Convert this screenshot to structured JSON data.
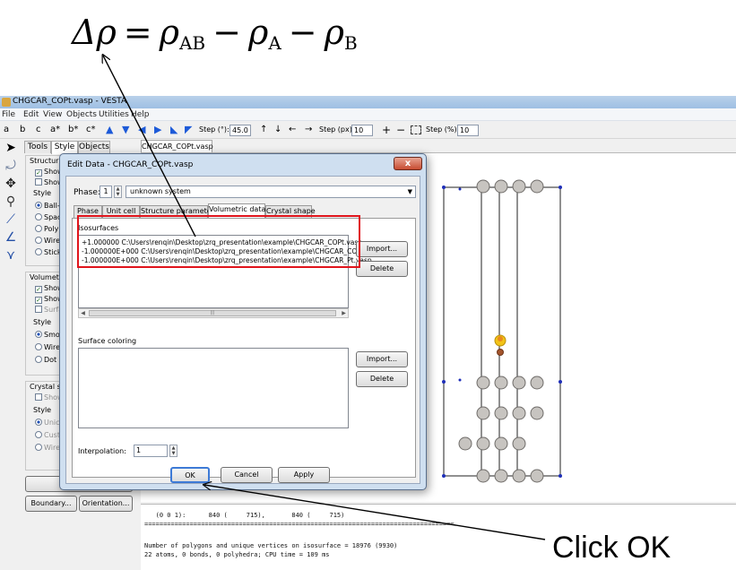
{
  "annotation": {
    "formula": {
      "delta_rho": "Δρ",
      "equals": "=",
      "minus": "−",
      "rho": "ρ",
      "sub_ab": "AB",
      "sub_a": "A",
      "sub_b": "B"
    },
    "instruction": "Click OK"
  },
  "window": {
    "title": "CHGCAR_COPt.vasp - VESTA"
  },
  "menu": [
    "File",
    "Edit",
    "View",
    "Objects",
    "Utilities",
    "Help"
  ],
  "toolbar": {
    "axes": [
      "a",
      "b",
      "c",
      "a*",
      "b*",
      "c*"
    ],
    "rotate_arrows": [
      "▲",
      "▼",
      "◀",
      "▶",
      "◣",
      "◤"
    ],
    "step_deg_label": "Step (°):",
    "step_deg_value": "45.0",
    "translate_arrows": [
      "↑",
      "↓",
      "←",
      "→"
    ],
    "step_px_label": "Step (px):",
    "step_px_value": "10",
    "zoom_in": "+",
    "zoom_out": "−",
    "step_pct_label": "Step (%):",
    "step_pct_value": "10"
  },
  "side_panel": {
    "tabs": [
      "Tools",
      "Style",
      "Objects"
    ],
    "structural_title": "Structura",
    "structural_rows": [
      "Show",
      "Show"
    ],
    "style_label": "Style",
    "style_options": [
      "Ball-",
      "Spac",
      "Poly",
      "Wire",
      "Stick"
    ],
    "volumetric_title": "Volumetr",
    "volumetric_rows": [
      "Show",
      "Show",
      "Surfa"
    ],
    "vol_style_options": [
      "Smo",
      "Wire",
      "Dot"
    ],
    "crystal_title": "Crystal sh",
    "crystal_rows": [
      "Show"
    ],
    "crystal_style_options": [
      "Unic",
      "Cust",
      "Wire"
    ],
    "boundary_button": "Boundary...",
    "orientation_button": "Orientation..."
  },
  "doc_tab": "CHGCAR_COPt.vasp",
  "console": {
    "lines": [
      "   (0 0 1):      840 (     715),       840 (     715)",
      "==================================================================================",
      "Number of polygons and unique vertices on isosurface = 18976 (9930)",
      "22 atoms, 0 bonds, 0 polyhedra; CPU time = 109 ms"
    ]
  },
  "dialog": {
    "title": "Edit Data - CHGCAR_COPt.vasp",
    "close": "x",
    "phase_label": "Phase:",
    "phase_value": "1",
    "phase_name": "unknown system",
    "tabs": [
      "Phase",
      "Unit cell",
      "Structure parameters",
      "Volumetric data",
      "Crystal shape"
    ],
    "isosurfaces_label": "Isosurfaces",
    "isosurfaces": [
      "+1.000000 C:\\Users\\renqin\\Desktop\\zrq_presentation\\example\\CHGCAR_COPt.vasp",
      "-1.000000E+000 C:\\Users\\renqin\\Desktop\\zrq_presentation\\example\\CHGCAR_CO.vasp",
      "-1.000000E+000 C:\\Users\\renqin\\Desktop\\zrq_presentation\\example\\CHGCAR_Pt.vasp"
    ],
    "import_label": "Import...",
    "delete_label": "Delete",
    "surface_coloring_label": "Surface coloring",
    "interpolation_label": "Interpolation:",
    "interpolation_value": "1",
    "ok_label": "OK",
    "cancel_label": "Cancel",
    "apply_label": "Apply"
  },
  "colors": {
    "highlight_box": "#e0141c",
    "arrow": "#000000",
    "cell_edge": "#1f2fb8",
    "atom": "#c7c4c0"
  },
  "icons": [
    "select-arrow-icon",
    "rotate-icon",
    "move-icon",
    "magnify-icon",
    "bond-length-icon",
    "bond-angle-icon",
    "dihedral-icon"
  ]
}
